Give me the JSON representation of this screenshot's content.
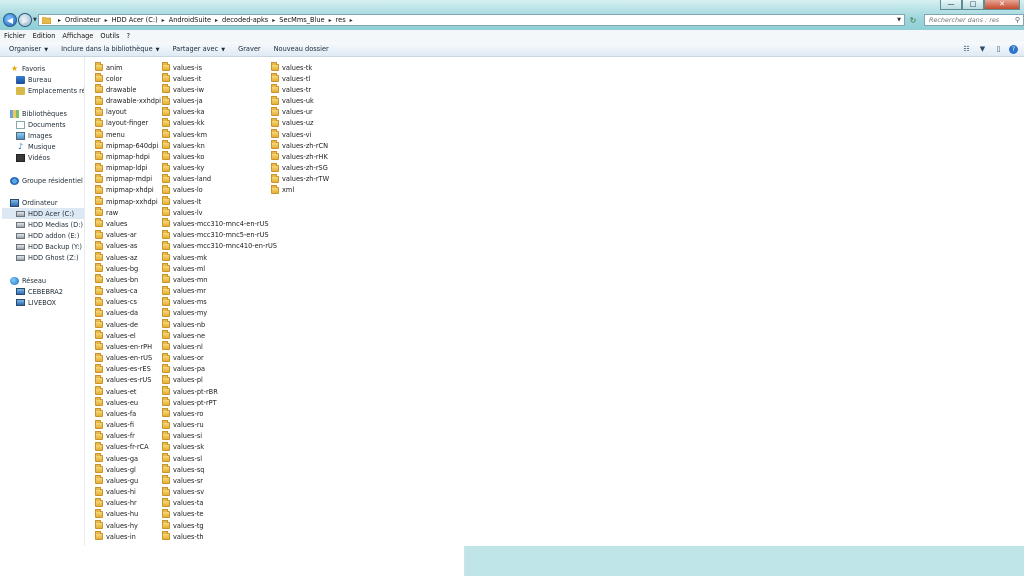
{
  "address_bar": {
    "breadcrumbs": [
      "Ordinateur",
      "HDD Acer (C:)",
      "AndroidSuite",
      "decoded-apks",
      "SecMms_Blue",
      "res"
    ]
  },
  "search": {
    "placeholder": "Rechercher dans : res"
  },
  "menubar": {
    "items": [
      "Fichier",
      "Edition",
      "Affichage",
      "Outils",
      "?"
    ]
  },
  "toolbar": {
    "organize": "Organiser",
    "include_library": "Inclure dans la bibliothèque",
    "share_with": "Partager avec",
    "burn": "Graver",
    "new_folder": "Nouveau dossier"
  },
  "nav_pane": {
    "favorites": "Favoris",
    "desktop": "Bureau",
    "recent_places": "Emplacements réce",
    "libraries": "Bibliothèques",
    "documents": "Documents",
    "images": "Images",
    "music": "Musique",
    "videos": "Vidéos",
    "homegroup": "Groupe résidentiel",
    "computer": "Ordinateur",
    "drives": [
      "HDD Acer (C:)",
      "HDD Medias (D:)",
      "HDD addon (E:)",
      "HDD Backup (Y:)",
      "HDD Ghost (Z:)"
    ],
    "network": "Réseau",
    "network_items": [
      "CEBEBRA2",
      "LIVEBOX"
    ]
  },
  "files": {
    "col1": [
      "anim",
      "color",
      "drawable",
      "drawable-xxhdpi",
      "layout",
      "layout-finger",
      "menu",
      "mipmap-640dpi",
      "mipmap-hdpi",
      "mipmap-ldpi",
      "mipmap-mdpi",
      "mipmap-xhdpi",
      "mipmap-xxhdpi",
      "raw",
      "values",
      "values-ar",
      "values-as",
      "values-az",
      "values-bg",
      "values-bn",
      "values-ca",
      "values-cs",
      "values-da",
      "values-de",
      "values-el",
      "values-en-rPH",
      "values-en-rUS",
      "values-es-rES",
      "values-es-rUS",
      "values-et",
      "values-eu",
      "values-fa",
      "values-fi",
      "values-fr",
      "values-fr-rCA",
      "values-ga",
      "values-gl",
      "values-gu",
      "values-hi",
      "values-hr",
      "values-hu",
      "values-hy",
      "values-in"
    ],
    "col2": [
      "values-is",
      "values-it",
      "values-iw",
      "values-ja",
      "values-ka",
      "values-kk",
      "values-km",
      "values-kn",
      "values-ko",
      "values-ky",
      "values-land",
      "values-lo",
      "values-lt",
      "values-lv",
      "values-mcc310-mnc4-en-rUS",
      "values-mcc310-mnc5-en-rUS",
      "values-mcc310-mnc410-en-rUS",
      "values-mk",
      "values-ml",
      "values-mn",
      "values-mr",
      "values-ms",
      "values-my",
      "values-nb",
      "values-ne",
      "values-nl",
      "values-or",
      "values-pa",
      "values-pl",
      "values-pt-rBR",
      "values-pt-rPT",
      "values-ro",
      "values-ru",
      "values-si",
      "values-sk",
      "values-sl",
      "values-sq",
      "values-sr",
      "values-sv",
      "values-ta",
      "values-te",
      "values-tg",
      "values-th"
    ],
    "col3": [
      "values-tk",
      "values-tl",
      "values-tr",
      "values-uk",
      "values-ur",
      "values-uz",
      "values-vi",
      "values-zh-rCN",
      "values-zh-rHK",
      "values-zh-rSG",
      "values-zh-rTW",
      "xml"
    ]
  },
  "icons": {
    "minimize": "—",
    "maximize": "□",
    "close": "✕",
    "back": "◀",
    "forward": "▶",
    "dropdown": "▼",
    "separator": "▸",
    "refresh": "↻",
    "search": "⚲",
    "views": "☷",
    "preview": "▯",
    "help": "?"
  }
}
